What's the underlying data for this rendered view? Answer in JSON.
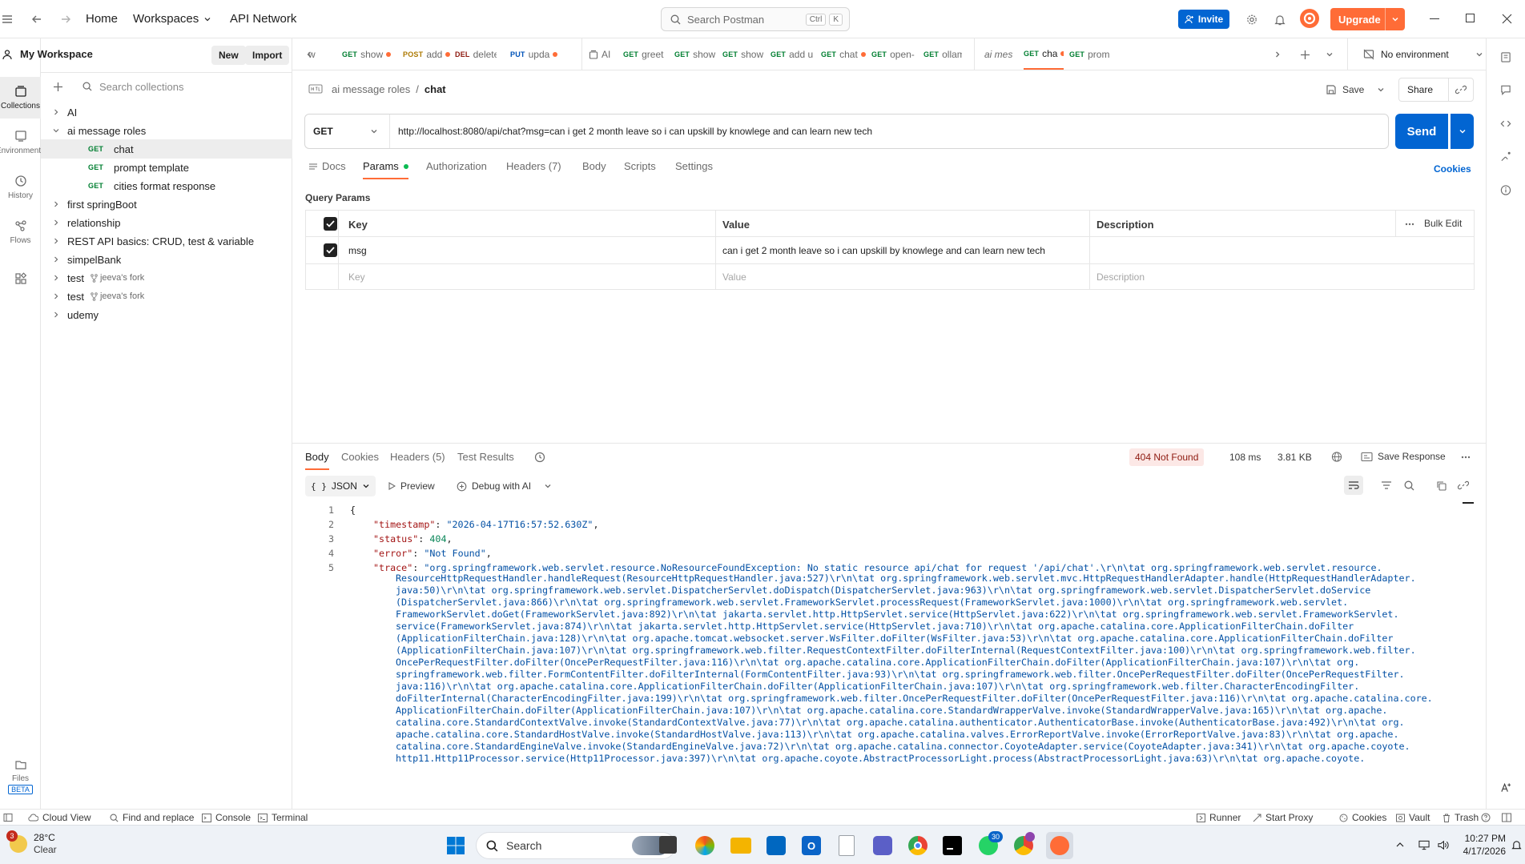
{
  "topbar": {
    "home": "Home",
    "workspaces": "Workspaces",
    "api_network": "API Network",
    "search_placeholder": "Search Postman",
    "shortcut_ctrl": "Ctrl",
    "shortcut_k": "K",
    "invite": "Invite",
    "upgrade": "Upgrade"
  },
  "leftrail": {
    "collections": "Collections",
    "environments": "Environments",
    "history": "History",
    "flows": "Flows",
    "files": "Files",
    "beta": "BETA"
  },
  "sidebar": {
    "workspace": "My Workspace",
    "new": "New",
    "import": "Import",
    "search_placeholder": "Search collections",
    "items": [
      {
        "label": "AI"
      },
      {
        "label": "ai message roles"
      },
      {
        "label": "chat",
        "method": "GET"
      },
      {
        "label": "prompt template",
        "method": "GET"
      },
      {
        "label": "cities format response",
        "method": "GET"
      },
      {
        "label": "first springBoot"
      },
      {
        "label": "relationship"
      },
      {
        "label": "REST API basics: CRUD, test & variable"
      },
      {
        "label": "simpelBank"
      },
      {
        "label": "test",
        "fork": "jeeva's fork"
      },
      {
        "label": "test",
        "fork": "jeeva's fork"
      },
      {
        "label": "udemy"
      }
    ]
  },
  "tabs": [
    {
      "method": "",
      "label": "w"
    },
    {
      "method": "GET",
      "label": "show"
    },
    {
      "method": "POST",
      "label": "add"
    },
    {
      "method": "DEL",
      "label": "delete"
    },
    {
      "method": "PUT",
      "label": "upda"
    },
    {
      "method": "",
      "label": "AI"
    },
    {
      "method": "GET",
      "label": "greet"
    },
    {
      "method": "GET",
      "label": "show"
    },
    {
      "method": "GET",
      "label": "show"
    },
    {
      "method": "GET",
      "label": "add u"
    },
    {
      "method": "GET",
      "label": "chat"
    },
    {
      "method": "GET",
      "label": "open-"
    },
    {
      "method": "GET",
      "label": "ollam"
    },
    {
      "method": "",
      "label": "ai mes"
    },
    {
      "method": "GET",
      "label": "cha"
    },
    {
      "method": "GET",
      "label": "prom"
    }
  ],
  "environment": "No environment",
  "request": {
    "breadcrumb_parent": "ai message roles",
    "breadcrumb_sep": "/",
    "name": "chat",
    "save": "Save",
    "share": "Share",
    "method": "GET",
    "url": "http://localhost:8080/api/chat?msg=can i get 2 month leave so i can upskill by knowlege and can learn new tech",
    "send": "Send"
  },
  "request_tabs": [
    "Docs",
    "Params",
    "Authorization",
    "Headers (7)",
    "Body",
    "Scripts",
    "Settings"
  ],
  "cookies": "Cookies",
  "query_params": {
    "title": "Query Params",
    "headers": [
      "Key",
      "Value",
      "Description"
    ],
    "bulk_edit": "Bulk Edit",
    "rows": [
      {
        "key": "msg",
        "value": "can i get 2 month leave so i can upskill by knowlege and can learn new tech",
        "description": ""
      }
    ],
    "placeholder_key": "Key",
    "placeholder_value": "Value",
    "placeholder_desc": "Description"
  },
  "response": {
    "tabs": [
      "Body",
      "Cookies",
      "Headers (5)",
      "Test Results"
    ],
    "status": "404 Not Found",
    "time": "108 ms",
    "size": "3.81 KB",
    "save_response": "Save Response",
    "format": "JSON",
    "preview": "Preview",
    "debug": "Debug with AI",
    "line_numbers": [
      "1",
      "2",
      "3",
      "4",
      "5"
    ],
    "brace": "{",
    "timestamp_key": "\"timestamp\"",
    "timestamp_val": "\"2026-04-17T16:57:52.630Z\"",
    "status_key": "\"status\"",
    "status_val": "404",
    "error_key": "\"error\"",
    "error_val": "\"Not Found\"",
    "trace_key": "\"trace\"",
    "trace_lines": [
      "\"org.springframework.web.servlet.resource.NoResourceFoundException: No static resource api/chat for request '/api/chat'.\\r\\n\\tat org.springframework.web.servlet.resource.",
      "ResourceHttpRequestHandler.handleRequest(ResourceHttpRequestHandler.java:527)\\r\\n\\tat org.springframework.web.servlet.mvc.HttpRequestHandlerAdapter.handle(HttpRequestHandlerAdapter.",
      "java:50)\\r\\n\\tat org.springframework.web.servlet.DispatcherServlet.doDispatch(DispatcherServlet.java:963)\\r\\n\\tat org.springframework.web.servlet.DispatcherServlet.doService",
      "(DispatcherServlet.java:866)\\r\\n\\tat org.springframework.web.servlet.FrameworkServlet.processRequest(FrameworkServlet.java:1000)\\r\\n\\tat org.springframework.web.servlet.",
      "FrameworkServlet.doGet(FrameworkServlet.java:892)\\r\\n\\tat jakarta.servlet.http.HttpServlet.service(HttpServlet.java:622)\\r\\n\\tat org.springframework.web.servlet.FrameworkServlet.",
      "service(FrameworkServlet.java:874)\\r\\n\\tat jakarta.servlet.http.HttpServlet.service(HttpServlet.java:710)\\r\\n\\tat org.apache.catalina.core.ApplicationFilterChain.doFilter",
      "(ApplicationFilterChain.java:128)\\r\\n\\tat org.apache.tomcat.websocket.server.WsFilter.doFilter(WsFilter.java:53)\\r\\n\\tat org.apache.catalina.core.ApplicationFilterChain.doFilter",
      "(ApplicationFilterChain.java:107)\\r\\n\\tat org.springframework.web.filter.RequestContextFilter.doFilterInternal(RequestContextFilter.java:100)\\r\\n\\tat org.springframework.web.filter.",
      "OncePerRequestFilter.doFilter(OncePerRequestFilter.java:116)\\r\\n\\tat org.apache.catalina.core.ApplicationFilterChain.doFilter(ApplicationFilterChain.java:107)\\r\\n\\tat org.",
      "springframework.web.filter.FormContentFilter.doFilterInternal(FormContentFilter.java:93)\\r\\n\\tat org.springframework.web.filter.OncePerRequestFilter.doFilter(OncePerRequestFilter.",
      "java:116)\\r\\n\\tat org.apache.catalina.core.ApplicationFilterChain.doFilter(ApplicationFilterChain.java:107)\\r\\n\\tat org.springframework.web.filter.CharacterEncodingFilter.",
      "doFilterInternal(CharacterEncodingFilter.java:199)\\r\\n\\tat org.springframework.web.filter.OncePerRequestFilter.doFilter(OncePerRequestFilter.java:116)\\r\\n\\tat org.apache.catalina.core.",
      "ApplicationFilterChain.doFilter(ApplicationFilterChain.java:107)\\r\\n\\tat org.apache.catalina.core.StandardWrapperValve.invoke(StandardWrapperValve.java:165)\\r\\n\\tat org.apache.",
      "catalina.core.StandardContextValve.invoke(StandardContextValve.java:77)\\r\\n\\tat org.apache.catalina.authenticator.AuthenticatorBase.invoke(AuthenticatorBase.java:492)\\r\\n\\tat org.",
      "apache.catalina.core.StandardHostValve.invoke(StandardHostValve.java:113)\\r\\n\\tat org.apache.catalina.valves.ErrorReportValve.invoke(ErrorReportValve.java:83)\\r\\n\\tat org.apache.",
      "catalina.core.StandardEngineValve.invoke(StandardEngineValve.java:72)\\r\\n\\tat org.apache.catalina.connector.CoyoteAdapter.service(CoyoteAdapter.java:341)\\r\\n\\tat org.apache.coyote.",
      "http11.Http11Processor.service(Http11Processor.java:397)\\r\\n\\tat org.apache.coyote.AbstractProcessorLight.process(AbstractProcessorLight.java:63)\\r\\n\\tat org.apache.coyote."
    ]
  },
  "statusbar": {
    "cloud_view": "Cloud View",
    "find_replace": "Find and replace",
    "console": "Console",
    "terminal": "Terminal",
    "runner": "Runner",
    "start_proxy": "Start Proxy",
    "cookies": "Cookies",
    "vault": "Vault",
    "trash": "Trash"
  },
  "taskbar": {
    "weather_temp": "28°C",
    "weather_desc": "Clear",
    "weather_badge": "3",
    "search": "Search",
    "whatsapp_badge": "30",
    "time": "10:27 PM",
    "date": "4/17/2026"
  },
  "colors": {
    "accent": "#ff6c37",
    "primary_blue": "#0265d2",
    "get": "#007f31",
    "post": "#ad7a03",
    "delete": "#8e1a10",
    "put": "#0053b8",
    "error": "#8e1a10"
  }
}
